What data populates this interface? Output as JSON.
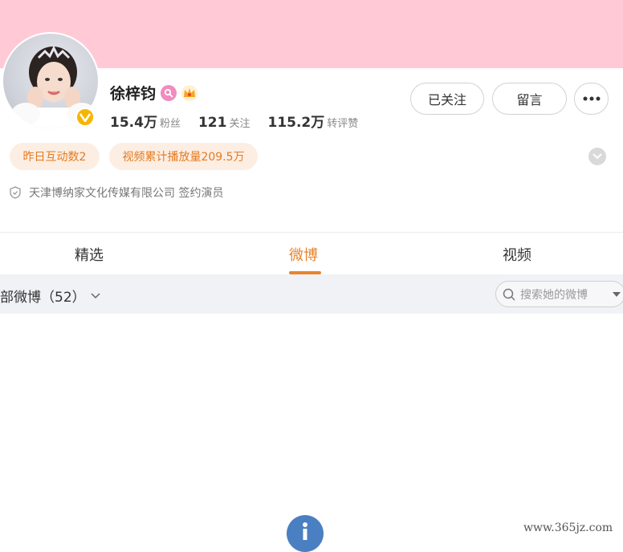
{
  "profile": {
    "name": "徐梓钧",
    "stats": [
      {
        "value": "15.4万",
        "label": "粉丝"
      },
      {
        "value": "121",
        "label": "关注"
      },
      {
        "value": "115.2万",
        "label": "转评赞"
      }
    ],
    "chips": [
      "昨日互动数2",
      "视频累计播放量209.5万"
    ],
    "company": "天津博纳家文化传媒有限公司 签约演员"
  },
  "actions": {
    "follow_label": "已关注",
    "message_label": "留言"
  },
  "tabs": [
    {
      "label": "精选",
      "active": false
    },
    {
      "label": "微博",
      "active": true
    },
    {
      "label": "视频",
      "active": false
    }
  ],
  "filter": {
    "label": "部微博（52）",
    "search_placeholder": "搜索她的微博"
  },
  "watermark": "www.365jz.com",
  "colors": {
    "banner": "#ffcad6",
    "accent": "#e8852b",
    "chip_bg": "#fdeee3",
    "verify": "#f7b500"
  }
}
